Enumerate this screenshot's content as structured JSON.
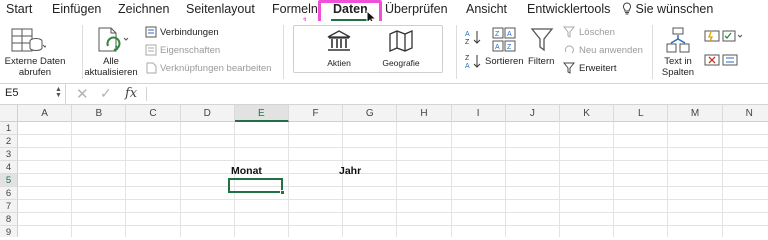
{
  "tabs": [
    "Start",
    "Einfügen",
    "Zeichnen",
    "Seitenlayout",
    "Formeln",
    "Daten",
    "Überprüfen",
    "Ansicht",
    "Entwicklertools"
  ],
  "tell_me": "Sie wünschen",
  "active_tab": "Daten",
  "annotation_number": "1",
  "ribbon": {
    "externe_daten": "Externe Daten abrufen",
    "alle_aktualisieren": "Alle aktualisieren",
    "verbindungen": "Verbindungen",
    "eigenschaften": "Eigenschaften",
    "verknuepfungen": "Verknüpfungen bearbeiten",
    "aktien": "Aktien",
    "geografie": "Geografie",
    "sortieren": "Sortieren",
    "filtern": "Filtern",
    "loeschen": "Löschen",
    "neu_anwenden": "Neu anwenden",
    "erweitert": "Erweitert",
    "text_in_spalten": "Text in Spalten"
  },
  "formula_bar": {
    "name_box": "E5",
    "cancel_glyph": "✕",
    "enter_glyph": "✓",
    "fx": "fx",
    "formula": ""
  },
  "sheet": {
    "columns": [
      "A",
      "B",
      "C",
      "D",
      "E",
      "F",
      "G",
      "H",
      "I",
      "J",
      "K",
      "L",
      "M",
      "N"
    ],
    "rows": [
      "1",
      "2",
      "3",
      "4",
      "5",
      "6",
      "7",
      "8",
      "9"
    ],
    "active_column": "E",
    "active_row": "5",
    "cells": {
      "E4": "Monat",
      "G4": "Jahr"
    }
  },
  "colors": {
    "accent_green": "#207245",
    "highlight_pink": "#f04fd8"
  }
}
